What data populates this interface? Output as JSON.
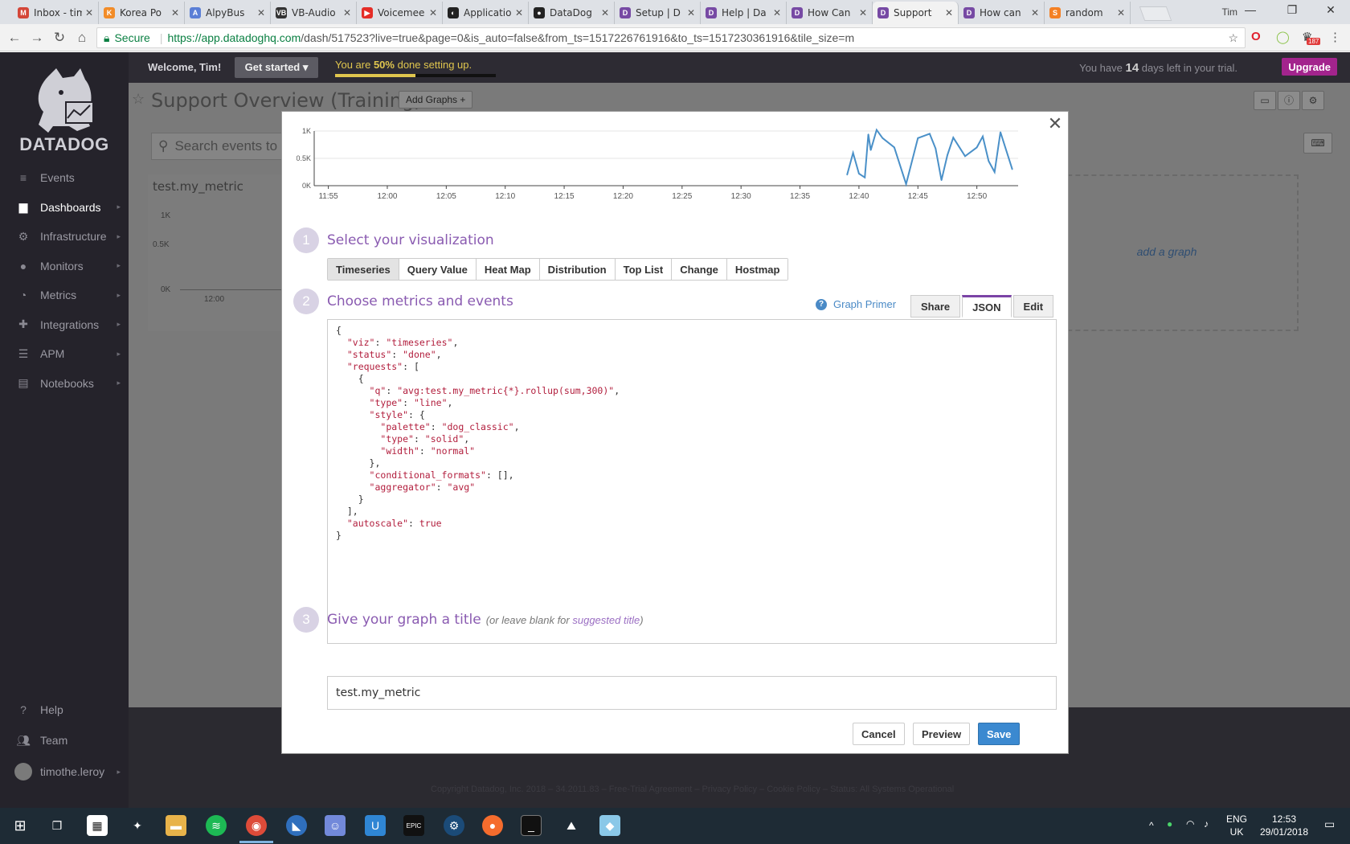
{
  "browser": {
    "tabs": [
      {
        "label": "Inbox - tim",
        "color": "#d44638",
        "glyph": "M",
        "active": false
      },
      {
        "label": "Korea Po",
        "color": "#f28c28",
        "glyph": "K",
        "active": false
      },
      {
        "label": "AlpyBus",
        "color": "#5b7fd6",
        "glyph": "A",
        "active": false
      },
      {
        "label": "VB-Audio",
        "color": "#333333",
        "glyph": "VB",
        "active": false
      },
      {
        "label": "Voicemee",
        "color": "#e52d27",
        "glyph": "▶",
        "active": false
      },
      {
        "label": "Applicatio",
        "color": "#222222",
        "glyph": "◐",
        "active": false
      },
      {
        "label": "DataDog",
        "color": "#222222",
        "glyph": "●",
        "active": false
      },
      {
        "label": "Setup | D",
        "color": "#774aa4",
        "glyph": "D",
        "active": false
      },
      {
        "label": "Help | Da",
        "color": "#774aa4",
        "glyph": "D",
        "active": false
      },
      {
        "label": "How Can",
        "color": "#774aa4",
        "glyph": "D",
        "active": false
      },
      {
        "label": "Support",
        "color": "#774aa4",
        "glyph": "D",
        "active": true
      },
      {
        "label": "How can",
        "color": "#774aa4",
        "glyph": "D",
        "active": false
      },
      {
        "label": "random",
        "color": "#f48024",
        "glyph": "S",
        "active": false
      }
    ],
    "user": "Tim",
    "secure_label": "Secure",
    "url_main": "https://app.datadoghq.com",
    "url_rest": "/dash/517523?live=true&page=0&is_auto=false&from_ts=1517226761916&to_ts=1517230361916&tile_size=m",
    "ext_badge": "187"
  },
  "sidebar": {
    "logo": "DATADOG",
    "items": [
      {
        "label": "Events",
        "icon": "≡"
      },
      {
        "label": "Dashboards",
        "icon": "▆"
      },
      {
        "label": "Infrastructure",
        "icon": "⚙"
      },
      {
        "label": "Monitors",
        "icon": "●"
      },
      {
        "label": "Metrics",
        "icon": "◔"
      },
      {
        "label": "Integrations",
        "icon": "✚"
      },
      {
        "label": "APM",
        "icon": "☰"
      },
      {
        "label": "Notebooks",
        "icon": "▤"
      }
    ],
    "help": "Help",
    "team": "Team",
    "user": "timothe.leroy"
  },
  "topbar": {
    "welcome": "Welcome, Tim!",
    "get_started": "Get started ▾",
    "setup_prefix": "You are ",
    "setup_percent": "50%",
    "setup_suffix": " done setting up.",
    "setup_progress": 0.5,
    "trial_prefix": "You have ",
    "trial_days": "14",
    "trial_suffix": " days left in your trial.",
    "upgrade": "Upgrade"
  },
  "dashboard": {
    "title": "Support Overview (Training)",
    "add_graphs": "Add Graphs +",
    "search_placeholder": "Search events to",
    "widget_title": "test.my_metric",
    "widget_y_labels": [
      "1K",
      "0.5K",
      "0K"
    ],
    "widget_x_label": "12:00",
    "add_graph": "add a graph",
    "footer": "Copyright Datadog, Inc. 2018 – 34.2011.83 – Free-Trial Agreement – Privacy Policy – Cookie Policy – Status: All Systems Operational"
  },
  "modal": {
    "step1_num": "1",
    "step1_title": "Select your visualization",
    "viz_tabs": [
      "Timeseries",
      "Query Value",
      "Heat Map",
      "Distribution",
      "Top List",
      "Change",
      "Hostmap"
    ],
    "viz_active": "Timeseries",
    "step2_num": "2",
    "step2_title": "Choose metrics and events",
    "graph_primer": "Graph Primer",
    "edit_tabs": [
      "Share",
      "JSON",
      "Edit"
    ],
    "edit_active": "JSON",
    "json_text": "{\n  \"viz\": \"timeseries\",\n  \"status\": \"done\",\n  \"requests\": [\n    {\n      \"q\": \"avg:test.my_metric{*}.rollup(sum,300)\",\n      \"type\": \"line\",\n      \"style\": {\n        \"palette\": \"dog_classic\",\n        \"type\": \"solid\",\n        \"width\": \"normal\"\n      },\n      \"conditional_formats\": [],\n      \"aggregator\": \"avg\"\n    }\n  ],\n  \"autoscale\": true\n}",
    "step3_num": "3",
    "step3_title": "Give your graph a title",
    "step3_hint_prefix": "(or leave blank for ",
    "step3_hint_link": "suggested title",
    "step3_hint_suffix": ")",
    "title_value": "test.my_metric",
    "cancel": "Cancel",
    "preview": "Preview",
    "save": "Save"
  },
  "chart_data": {
    "type": "line",
    "x": [
      "12:39",
      "12:39.5",
      "12:40",
      "12:40.5",
      "12:40.8",
      "12:41",
      "12:41.5",
      "12:42",
      "12:43",
      "12:44",
      "12:45",
      "12:46",
      "12:46.5",
      "12:47",
      "12:47.5",
      "12:48",
      "12:49",
      "12:50",
      "12:50.5",
      "12:51",
      "12:51.5",
      "12:52",
      "12:53"
    ],
    "values": [
      200,
      600,
      220,
      150,
      940,
      650,
      1020,
      870,
      700,
      30,
      870,
      950,
      680,
      100,
      560,
      880,
      540,
      700,
      900,
      450,
      250,
      980,
      300
    ],
    "x_ticks": [
      "11:55",
      "12:00",
      "12:05",
      "12:10",
      "12:15",
      "12:20",
      "12:25",
      "12:30",
      "12:35",
      "12:40",
      "12:45",
      "12:50"
    ],
    "y_ticks": [
      "1K",
      "0.5K",
      "0K"
    ],
    "ylim": [
      0,
      1000
    ],
    "color": "#4a90c8",
    "grid": true
  }
}
